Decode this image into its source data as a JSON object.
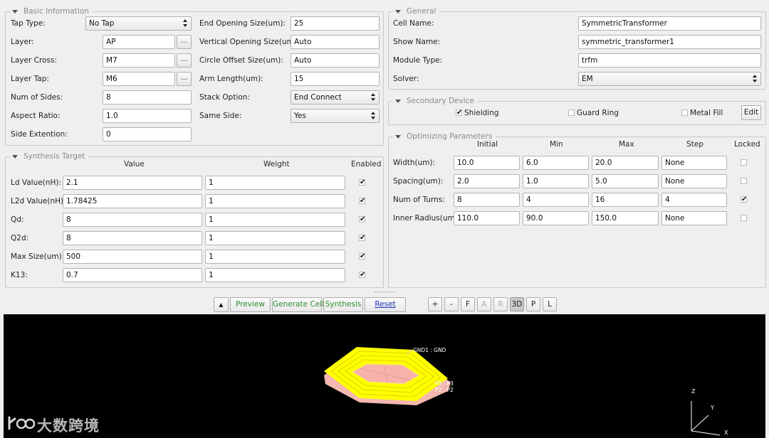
{
  "basic_info": {
    "title": "Basic Information",
    "tap_type_label": "Tap Type:",
    "tap_type_value": "No Tap",
    "layer_label": "Layer:",
    "layer_value": "AP",
    "layer_cross_label": "Layer Cross:",
    "layer_cross_value": "M7",
    "layer_tap_label": "Layer Tap:",
    "layer_tap_value": "M6",
    "browse_label": "...",
    "num_sides_label": "Num of Sides:",
    "num_sides_value": "8",
    "aspect_ratio_label": "Aspect Ratio:",
    "aspect_ratio_value": "1.0",
    "side_extention_label": "Side Extention:",
    "side_extention_value": "0",
    "end_opening_label": "End Opening Size(um):",
    "end_opening_value": "25",
    "vertical_opening_label": "Vertical Opening Size(um):",
    "vertical_opening_value": "Auto",
    "circle_offset_label": "Circle Offset Size(um):",
    "circle_offset_value": "Auto",
    "arm_length_label": "Arm Length(um):",
    "arm_length_value": "15",
    "stack_option_label": "Stack Option:",
    "stack_option_value": "End Connect",
    "same_side_label": "Same Side:",
    "same_side_value": "Yes"
  },
  "synthesis": {
    "title": "Synthesis Target",
    "col_value": "Value",
    "col_weight": "Weight",
    "col_enabled": "Enabled",
    "rows": [
      {
        "label": "Ld Value(nH):",
        "value": "2.1",
        "weight": "1",
        "enabled": "✔"
      },
      {
        "label": "L2d Value(nH):",
        "value": "1.78425",
        "weight": "1",
        "enabled": "✔"
      },
      {
        "label": "Qd:",
        "value": "8",
        "weight": "1",
        "enabled": "✔"
      },
      {
        "label": "Q2d:",
        "value": "8",
        "weight": "1",
        "enabled": "✔"
      },
      {
        "label": "Max Size(um):",
        "value": "500",
        "weight": "1",
        "enabled": "✔"
      },
      {
        "label": "K13:",
        "value": "0.7",
        "weight": "1",
        "enabled": "✔"
      }
    ]
  },
  "general": {
    "title": "General",
    "cell_name_label": "Cell Name:",
    "cell_name_value": "SymmetricTransformer",
    "show_name_label": "Show Name:",
    "show_name_value": "symmetric_transformer1",
    "module_type_label": "Module Type:",
    "module_type_value": "trfm",
    "solver_label": "Solver:",
    "solver_value": "EM"
  },
  "secondary": {
    "title": "Secondary Device",
    "shielding_label": "Shielding",
    "shielding_mark": "✔",
    "guard_ring_label": "Guard Ring",
    "metal_fill_label": "Metal Fill",
    "edit_label": "Edit"
  },
  "optimizing": {
    "title": "Optimizing Parameters",
    "col_initial": "Initial",
    "col_min": "Min",
    "col_max": "Max",
    "col_step": "Step",
    "col_locked": "Locked",
    "rows": [
      {
        "label": "Width(um):",
        "initial": "10.0",
        "min": "6.0",
        "max": "20.0",
        "step": "None",
        "locked": ""
      },
      {
        "label": "Spacing(um):",
        "initial": "2.0",
        "min": "1.0",
        "max": "5.0",
        "step": "None",
        "locked": ""
      },
      {
        "label": "Num of Turns:",
        "initial": "8",
        "min": "4",
        "max": "16",
        "step": "4",
        "locked": "✔"
      },
      {
        "label": "Inner Radius(um):",
        "initial": "110.0",
        "min": "90.0",
        "max": "150.0",
        "step": "None",
        "locked": ""
      }
    ]
  },
  "toolbar": {
    "collapse_label": "▲",
    "preview_label": "Preview",
    "generate_cell_label": "Generate Cell",
    "synthesis_label": "Synthesis",
    "reset_label": "Reset",
    "zoom_in_label": "+",
    "zoom_out_label": "-",
    "fit_label": "F",
    "a_label": "A",
    "r_label": "R",
    "view_3d_label": "3D",
    "p_label": "P",
    "l_label": "L"
  },
  "viewport": {
    "port_gnd": "GND1 : GND",
    "port_p3": "P3 : P3",
    "port_p2": "P2 : P2",
    "axis_z": "Z",
    "axis_y": "Y",
    "axis_x": "X",
    "watermark": "大数跨境",
    "colors": {
      "background": "#000000",
      "metal": "#ffff00",
      "substrate": "#f4b8ae"
    }
  }
}
